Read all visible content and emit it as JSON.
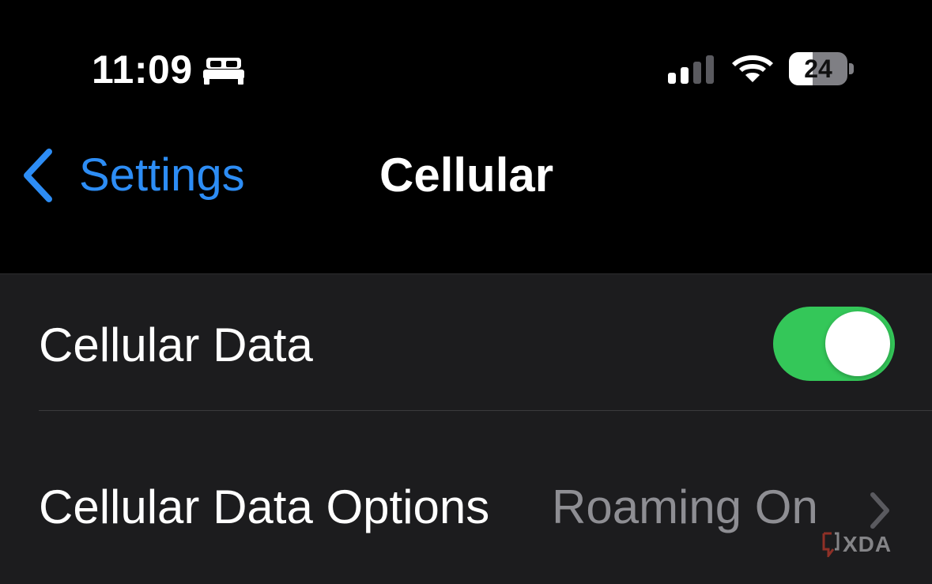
{
  "status_bar": {
    "time": "11:09",
    "focus_icon": "bed-icon",
    "signal_icon": "cellular-signal-icon",
    "signal_bars_active": 2,
    "signal_bars_total": 4,
    "wifi_icon": "wifi-icon",
    "battery_percent": "24",
    "battery_level": 0.24
  },
  "nav": {
    "back_label": "Settings",
    "back_icon": "chevron-left-icon",
    "title": "Cellular"
  },
  "rows": [
    {
      "label": "Cellular Data",
      "control": "toggle",
      "toggle_on": true
    },
    {
      "label": "Cellular Data Options",
      "value": "Roaming On",
      "accessory_icon": "chevron-right-icon"
    }
  ],
  "watermark": {
    "text": "XDA",
    "icon": "xda-logo-icon"
  },
  "colors": {
    "background": "#000000",
    "group_background": "#1c1c1e",
    "accent_blue": "#2d8df5",
    "toggle_on": "#34c759",
    "secondary_text": "#8e8e93"
  }
}
